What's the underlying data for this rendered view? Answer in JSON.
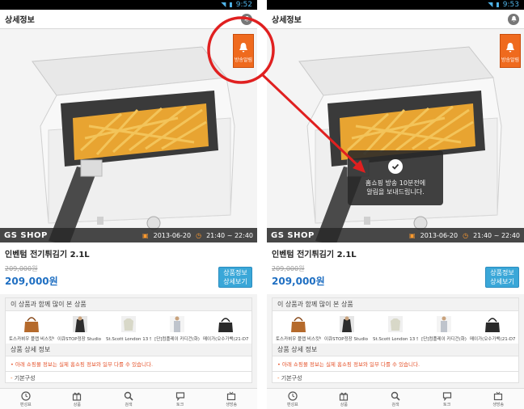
{
  "screens": [
    {
      "time": "9:52",
      "title": "상세정보",
      "brand": "GS SHOP",
      "date": "2013-06-20",
      "time_range": "21:40 ~ 22:40",
      "product_name": "인벤텀 전기튀김기 2.1L",
      "orig_price": "209,000원",
      "price": "209,000원",
      "detail_button": [
        "상품정보",
        "상세보기"
      ],
      "related_title": "이 상품과 함께 많이 본 상품",
      "related": [
        "토스카뷔우 플랩 비스킷백",
        "이큐STOP정장 Studio K with",
        "St.Scott London 13 S/S 오..",
        "[단]컴플레이 카디건(화)",
        "메이가(오수가백(21-D782)"
      ],
      "spec_title": "상품 상세 정보",
      "spec_note": "• 아래 쇼핑몰 정보는 실제 홈쇼핑 정보와 일부 다를 수 있습니다.",
      "basic": "기본구성",
      "alarm_label": "방송알림"
    },
    {
      "time": "9:53",
      "title": "상세정보",
      "brand": "GS SHOP",
      "date": "2013-06-20",
      "time_range": "21:40 ~ 22:40",
      "product_name": "인벤텀 전기튀김기 2.1L",
      "orig_price": "209,000원",
      "price": "209,000원",
      "detail_button": [
        "상품정보",
        "상세보기"
      ],
      "related_title": "이 상품과 함께 많이 본 상품",
      "related": [
        "토스카뷔우 플랩 비스킷백",
        "이큐STOP정장 Studio K with",
        "St.Scott London 13 S/S 오..",
        "[단]컴플레이 카디건(화)",
        "메이가(오수가백(21-D782)"
      ],
      "spec_title": "상품 상세 정보",
      "spec_note": "• 아래 쇼핑몰 정보는 실제 홈쇼핑 정보와 일부 다를 수 있습니다.",
      "basic": "기본구성",
      "alarm_label": "방송알림",
      "toast": [
        "홈쇼핑 방송 10분전에",
        "알림을 보내드립니다."
      ]
    }
  ],
  "nav": [
    "편성표",
    "상품",
    "검색",
    "토크",
    "생방송"
  ],
  "colors": {
    "accent_blue": "#1f6fc2",
    "button_blue": "#3aa7d8",
    "alarm_orange": "#ef6a1e",
    "annotation_red": "#e02020"
  }
}
